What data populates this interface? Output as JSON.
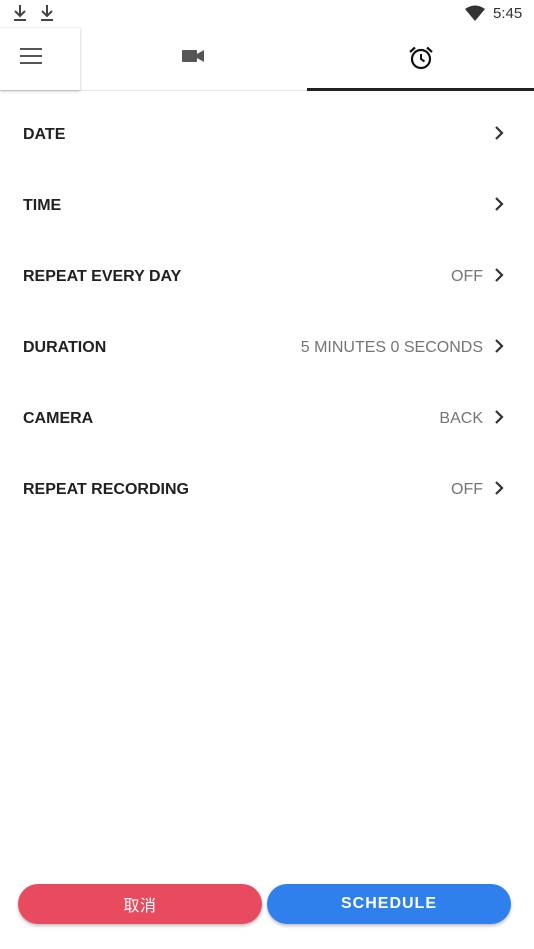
{
  "status_bar": {
    "time": "5:45",
    "icons": [
      "download-icon",
      "download-icon",
      "wifi-icon"
    ]
  },
  "tabs": [
    {
      "name": "menu",
      "icon": "hamburger-menu-icon"
    },
    {
      "name": "video",
      "icon": "video-camera-icon"
    },
    {
      "name": "schedule",
      "icon": "alarm-clock-icon",
      "selected": true
    }
  ],
  "settings": [
    {
      "label": "DATE",
      "value": ""
    },
    {
      "label": "TIME",
      "value": ""
    },
    {
      "label": "REPEAT EVERY DAY",
      "value": "OFF"
    },
    {
      "label": "DURATION",
      "value": "5 MINUTES 0 SECONDS"
    },
    {
      "label": "CAMERA",
      "value": "BACK"
    },
    {
      "label": "REPEAT RECORDING",
      "value": "OFF"
    }
  ],
  "actions": {
    "cancel_label": "取消",
    "schedule_label": "SCHEDULE"
  },
  "colors": {
    "cancel": "#e84a5f",
    "schedule": "#2f80ed",
    "indicator": "#222222"
  }
}
